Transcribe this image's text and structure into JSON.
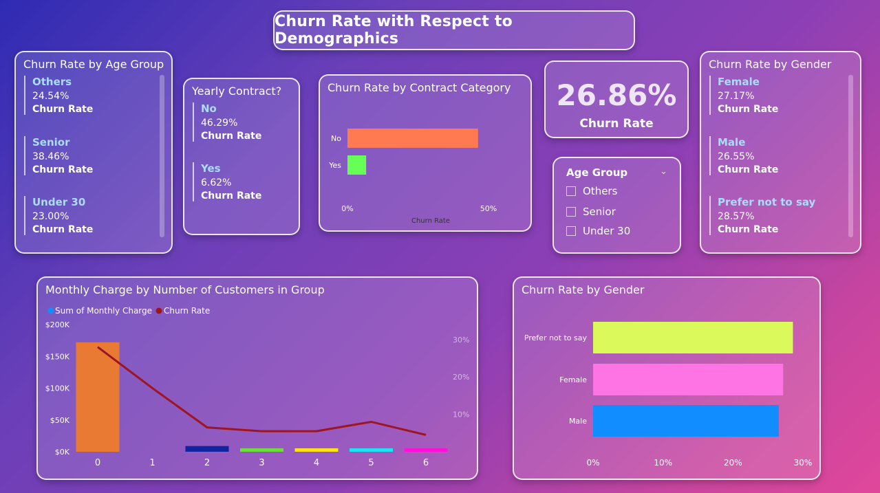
{
  "page_title": "Churn Rate with Respect to Demographics",
  "age_card": {
    "title": "Churn Rate by Age Group",
    "items": [
      {
        "name": "Others",
        "value": "24.54%",
        "sub": "Churn Rate"
      },
      {
        "name": "Senior",
        "value": "38.46%",
        "sub": "Churn Rate"
      },
      {
        "name": "Under 30",
        "value": "23.00%",
        "sub": "Churn Rate"
      }
    ]
  },
  "contract_card": {
    "title": "Yearly Contract?",
    "items": [
      {
        "name": "No",
        "value": "46.29%",
        "sub": "Churn Rate"
      },
      {
        "name": "Yes",
        "value": "6.62%",
        "sub": "Churn Rate"
      }
    ]
  },
  "kpi": {
    "value": "26.86%",
    "label": "Churn Rate"
  },
  "age_slicer": {
    "title": "Age Group",
    "options": [
      "Others",
      "Senior",
      "Under 30"
    ]
  },
  "gender_card": {
    "title": "Churn Rate by Gender",
    "items": [
      {
        "name": "Female",
        "value": "27.17%",
        "sub": "Churn Rate"
      },
      {
        "name": "Male",
        "value": "26.55%",
        "sub": "Churn Rate"
      },
      {
        "name": "Prefer not to say",
        "value": "28.57%",
        "sub": "Churn Rate"
      }
    ]
  },
  "colors": {
    "contract_no": "#ff7a50",
    "contract_yes": "#66ff55",
    "line": "#9e1520",
    "legend_bar": "#118dff",
    "legend_line": "#9e1520",
    "gender_prefer": "#dcf95c",
    "gender_female": "#ff74e4",
    "gender_male": "#118dff"
  },
  "chart_data": [
    {
      "type": "bar",
      "title": "Churn Rate by Contract Category",
      "categories": [
        "No",
        "Yes"
      ],
      "values": [
        46.29,
        6.62
      ],
      "xlabel": "Churn Rate",
      "xticks": [
        "0%",
        "50%"
      ],
      "xlim": [
        0,
        50
      ],
      "orientation": "horizontal"
    },
    {
      "type": "bar",
      "title": "Monthly Charge by Number of Customers in Group",
      "categories": [
        "0",
        "1",
        "2",
        "3",
        "4",
        "5",
        "6"
      ],
      "series": [
        {
          "name": "Sum of Monthly Charge",
          "values": [
            172000,
            0,
            9000,
            4000,
            3500,
            4500,
            4000
          ],
          "colors": [
            "#e87a34",
            "#e87a34",
            "#12239e",
            "#6edc3c",
            "#ffe21a",
            "#1ee3f5",
            "#ff0fd8"
          ]
        },
        {
          "name": "Churn Rate",
          "type": "line",
          "values": [
            28.0,
            17.0,
            6.5,
            5.5,
            5.5,
            8.0,
            4.5
          ]
        }
      ],
      "yticks": [
        "$0K",
        "$50K",
        "$100K",
        "$150K",
        "$200K"
      ],
      "ylim": [
        0,
        200000
      ],
      "y2ticks": [
        "10%",
        "20%",
        "30%"
      ],
      "y2lim": [
        0,
        34
      ]
    },
    {
      "type": "bar",
      "title": "Churn Rate by Gender",
      "categories": [
        "Prefer not to say",
        "Female",
        "Male"
      ],
      "values": [
        28.57,
        27.17,
        26.55
      ],
      "xticks": [
        "0%",
        "10%",
        "20%",
        "30%"
      ],
      "xlim": [
        0,
        30
      ],
      "orientation": "horizontal"
    }
  ]
}
